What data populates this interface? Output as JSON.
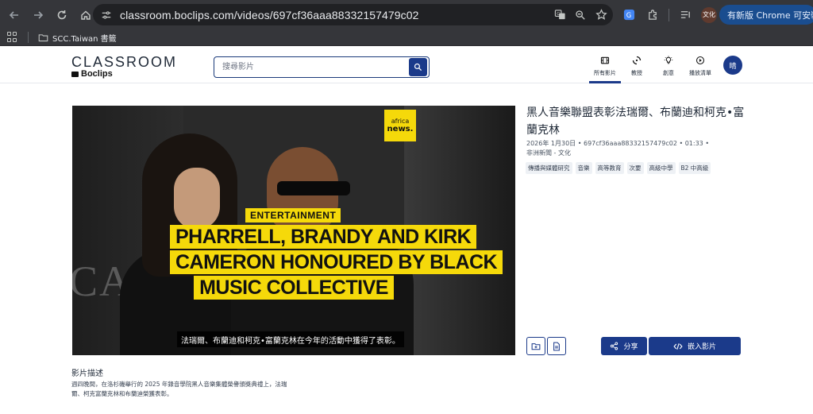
{
  "browser": {
    "url": "classroom.boclips.com/videos/697cf36aaa88332157479c02",
    "profile_label": "文化",
    "update_button": "有新版 Chrome 可安裝",
    "bookmarks": [
      {
        "label": "SCC.Taiwan 書籤"
      }
    ]
  },
  "header": {
    "logo_word": "CLASSROOM",
    "logo_sub": "Boclips",
    "search_placeholder": "搜尋影片",
    "nav": [
      {
        "label": "所有影片",
        "icon": "film-icon",
        "active": true
      },
      {
        "label": "教授",
        "icon": "loader-icon",
        "active": false
      },
      {
        "label": "創意",
        "icon": "lightbulb-icon",
        "active": false
      },
      {
        "label": "播放清單",
        "icon": "play-circle-icon",
        "active": false
      }
    ],
    "avatar_text": "晴"
  },
  "video": {
    "channel_logo_top": "africa",
    "channel_logo_bottom": "news.",
    "category_tag": "ENTERTAINMENT",
    "headline_lines": [
      "PHARRELL, BRANDY AND KIRK",
      "CAMERON HONOURED BY BLACK",
      "MUSIC COLLECTIVE"
    ],
    "caption": "法瑞爾、布蘭迪和柯克•富蘭克林在今年的活動中獲得了表彰。",
    "backdrop_text": "CA"
  },
  "details": {
    "title": "黑人音樂聯盟表彰法瑞爾、布蘭迪和柯克•富蘭克林",
    "meta_line": "2026年 1月30日 • 697cf36aaa88332157479c02 • 01:33 •",
    "meta_line2": "非洲新聞 - 文化",
    "tags": [
      "傳播與媒體研究",
      "音樂",
      "高等教育",
      "次要",
      "高級中學",
      "B2 中高級"
    ],
    "share_label": "分享",
    "embed_label": "嵌入影片"
  },
  "description": {
    "heading": "影片描述",
    "text": "週四晚間，在洛杉磯舉行的 2025 年錄音學院黑人音樂集體榮譽頒獎典禮上，法瑞爾、柯克富蘭克林和布蘭迪榮獲表彰。"
  },
  "colors": {
    "brand": "#1b3a8a",
    "chrome_bg": "#35363a",
    "highlight_yellow": "#f5d90a"
  }
}
